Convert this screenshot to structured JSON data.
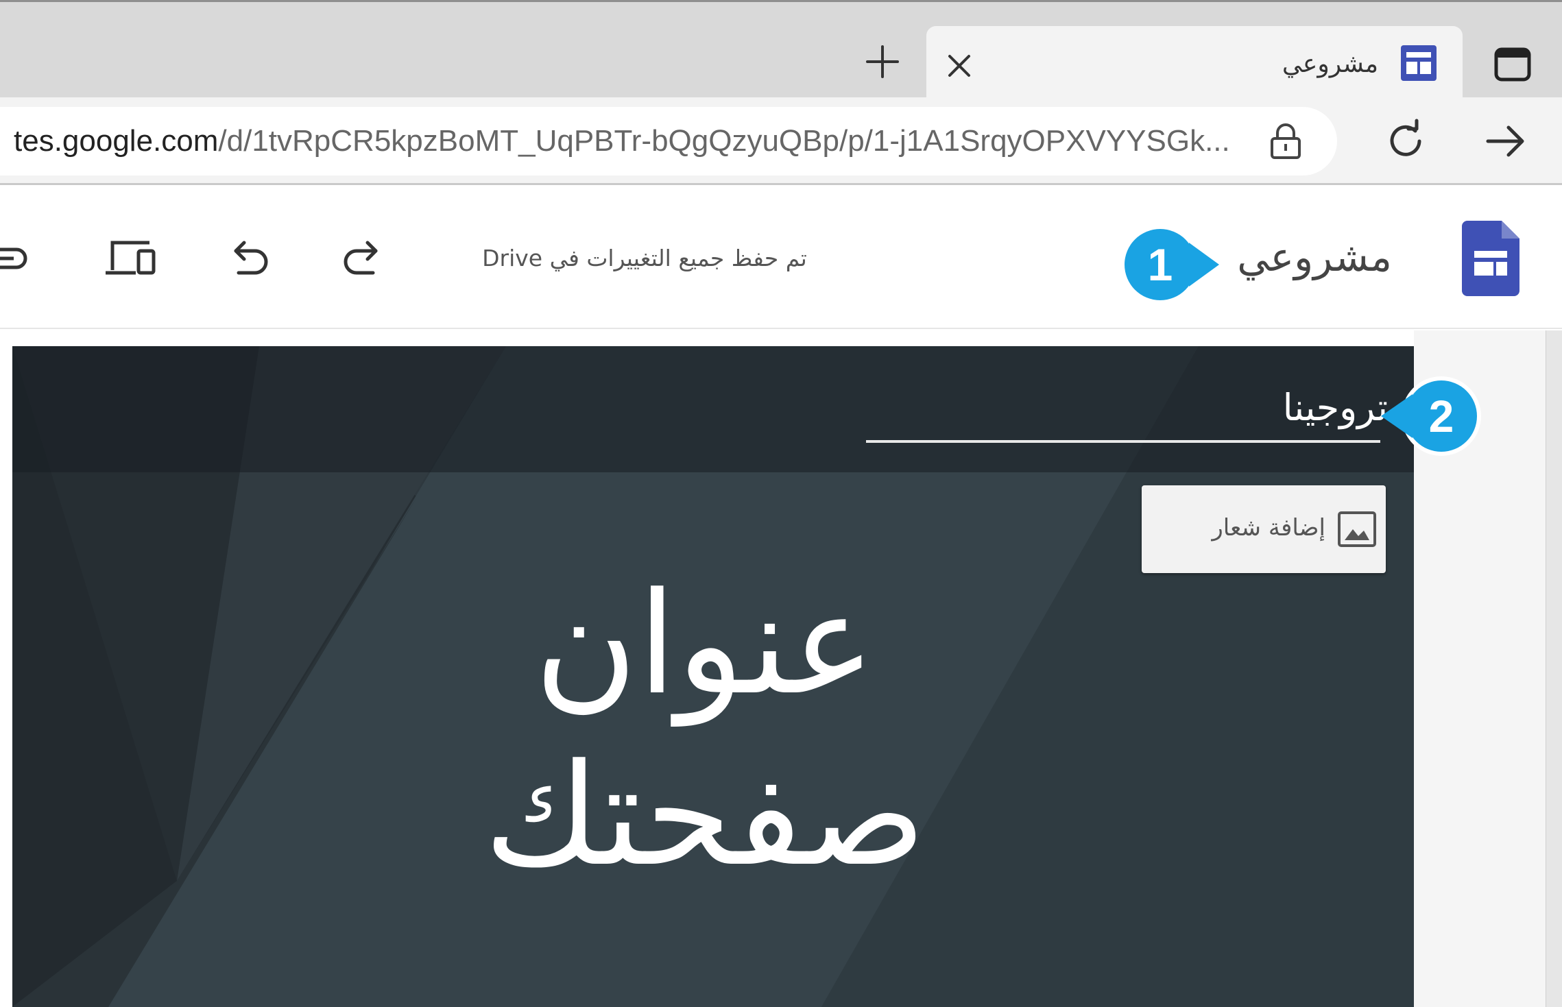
{
  "browser": {
    "tab": {
      "title": "مشروعي",
      "close_symbol": "×"
    },
    "new_tab_symbol": "+",
    "address_bar": {
      "url_host": "tes.google.com",
      "url_path": "/d/1tvRpCR5kpzBoMT_UqPBTr-bQgQzyuQBp/p/1-j1A1SrqyOPXVYYSGk..."
    }
  },
  "sites_toolbar": {
    "site_name": "مشروعي",
    "save_status": "تم حفظ جميع التغييرات في Drive"
  },
  "header": {
    "site_nav_title": "تروجينا",
    "add_logo_label": "إضافة شعار",
    "page_title": "عنوان صفحتك"
  },
  "callouts": {
    "first": "1",
    "second": "2"
  },
  "colors": {
    "callout_blue": "#1aa3e3",
    "sites_blue": "#3f51b5",
    "header_dark": "#2a3339"
  },
  "icons": [
    "window-icon",
    "sites-favicon-icon",
    "close-icon",
    "plus-icon",
    "lock-icon",
    "reload-icon",
    "forward-arrow-icon",
    "sites-logo-icon",
    "redo-icon",
    "undo-icon",
    "device-preview-icon",
    "link-icon",
    "image-icon"
  ]
}
